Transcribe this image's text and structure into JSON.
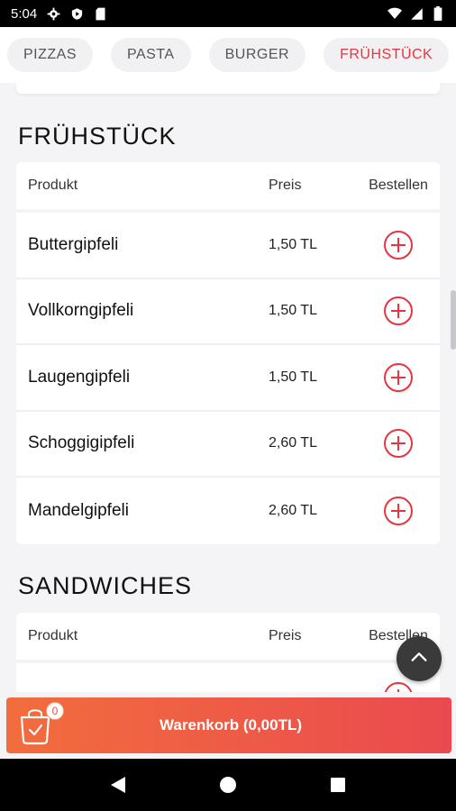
{
  "status_bar": {
    "time": "5:04"
  },
  "categories": [
    {
      "label": "PIZZAS",
      "active": false
    },
    {
      "label": "PASTA",
      "active": false
    },
    {
      "label": "BURGER",
      "active": false
    },
    {
      "label": "FRÜHSTÜCK",
      "active": true
    },
    {
      "label": "",
      "active": false
    }
  ],
  "sections": [
    {
      "title": "FRÜHSTÜCK",
      "headers": {
        "product": "Produkt",
        "price": "Preis",
        "order": "Bestellen"
      },
      "rows": [
        {
          "name": "Buttergipfeli",
          "price": "1,50 TL"
        },
        {
          "name": "Vollkorngipfeli",
          "price": "1,50 TL"
        },
        {
          "name": "Laugengipfeli",
          "price": "1,50 TL"
        },
        {
          "name": "Schoggigipfeli",
          "price": "2,60 TL"
        },
        {
          "name": "Mandelgipfeli",
          "price": "2,60 TL"
        }
      ]
    },
    {
      "title": "SANDWICHES",
      "headers": {
        "product": "Produkt",
        "price": "Preis",
        "order": "Bestellen"
      },
      "rows": [
        {
          "name": "",
          "price": ""
        }
      ]
    }
  ],
  "cart": {
    "label": "Warenkorb (0,00TL)",
    "count": "0"
  },
  "colors": {
    "accent": "#e8343f",
    "cart_gradient_start": "#f26d3d",
    "cart_gradient_end": "#ea4a4f"
  },
  "icons": {
    "status": [
      "settings-icon",
      "play-protect-icon",
      "sd-card-icon",
      "wifi-icon",
      "signal-icon",
      "battery-icon"
    ],
    "row_action": "add-circle-icon",
    "scroll_top": "chevron-up-icon",
    "cart": "shopping-bag-icon",
    "nav": [
      "back-icon",
      "home-icon",
      "recents-icon"
    ]
  }
}
